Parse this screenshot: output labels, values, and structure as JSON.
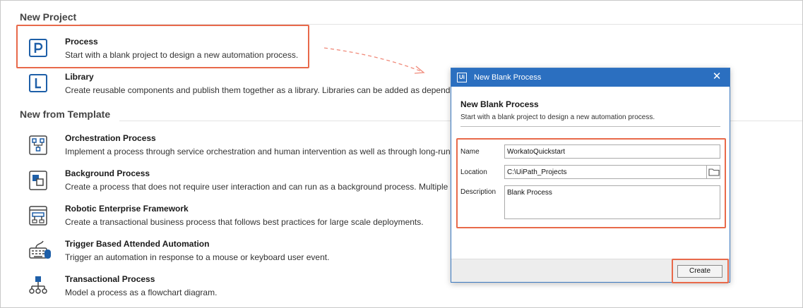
{
  "new_project": {
    "title": "New Project",
    "items": [
      {
        "name": "Process",
        "desc": "Start with a blank project to design a new automation process."
      },
      {
        "name": "Library",
        "desc": "Create reusable components and publish them together as a library. Libraries can be added as dependen"
      }
    ]
  },
  "new_from_template": {
    "title": "New from Template",
    "items": [
      {
        "name": "Orchestration Process",
        "desc": "Implement a process through service orchestration and human intervention as well as through long-run"
      },
      {
        "name": "Background Process",
        "desc": "Create a process that does not require user interaction and can run as a background process. Multiple ba"
      },
      {
        "name": "Robotic Enterprise Framework",
        "desc": "Create a transactional business process that follows best practices for large scale deployments."
      },
      {
        "name": "Trigger Based Attended Automation",
        "desc": "Trigger an automation in response to a mouse or keyboard user event."
      },
      {
        "name": "Transactional Process",
        "desc": "Model a process as a flowchart diagram."
      }
    ]
  },
  "dialog": {
    "logo": "Ui",
    "title": "New Blank Process",
    "close": "✕",
    "heading": "New Blank Process",
    "subtitle": "Start with a blank project to design a new automation process.",
    "name_label": "Name",
    "name_value": "WorkatoQuickstart",
    "location_label": "Location",
    "location_value": "C:\\UiPath_Projects",
    "description_label": "Description",
    "description_value": "Blank Process",
    "create_label": "Create"
  },
  "colors": {
    "accent": "#2b6fc0",
    "highlight": "#e8694a",
    "icon": "#1e5fa8"
  }
}
